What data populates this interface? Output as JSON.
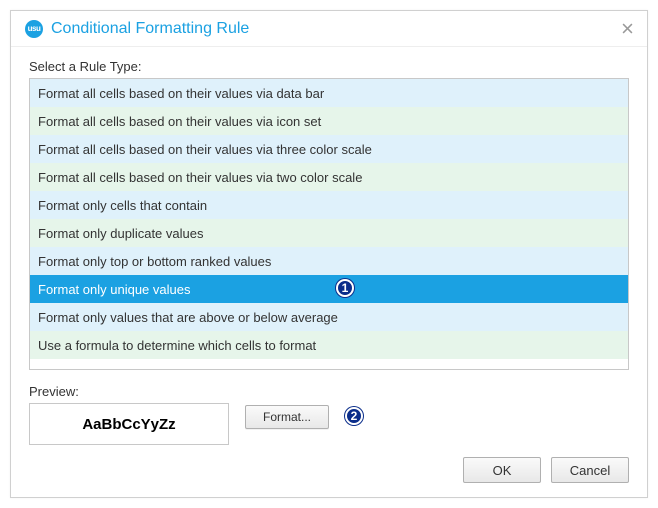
{
  "dialog": {
    "title": "Conditional Formatting Rule"
  },
  "labels": {
    "select_rule": "Select a Rule Type:",
    "preview": "Preview:"
  },
  "rules": [
    "Format all cells based on their values via data bar",
    "Format all cells based on their values via icon set",
    "Format all cells based on their values via three color scale",
    "Format all cells based on their values via two color scale",
    "Format only cells that contain",
    "Format only duplicate values",
    "Format only top or bottom ranked values",
    "Format only unique values",
    "Format only values that are above or below average",
    "Use a formula to determine which cells to format"
  ],
  "selected_rule_index": 7,
  "annotations": {
    "one": "1",
    "two": "2"
  },
  "preview": {
    "sample": "AaBbCcYyZz"
  },
  "buttons": {
    "format": "Format...",
    "ok": "OK",
    "cancel": "Cancel"
  }
}
